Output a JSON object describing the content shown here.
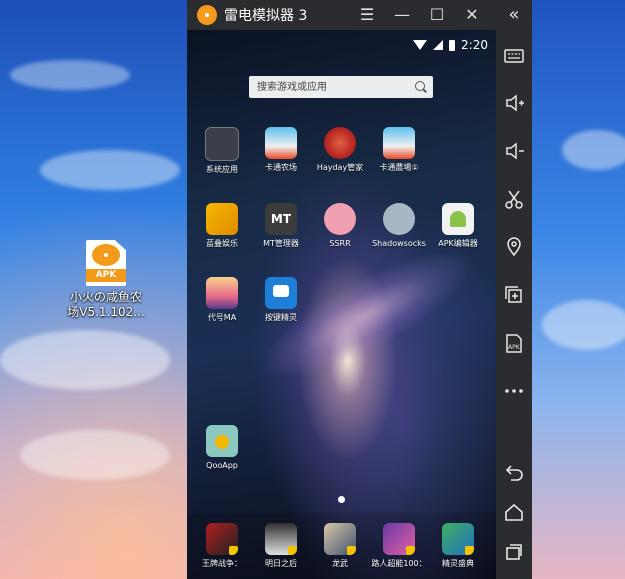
{
  "desktop": {
    "file": {
      "badge": "APK",
      "label_line1": "小火の咸鱼农",
      "label_line2": "场V5.1.102..."
    }
  },
  "window": {
    "title": "雷电模拟器 3",
    "controls": {
      "menu": "☰",
      "minimize": "—",
      "maximize": "☐",
      "close": "✕"
    },
    "collapse": "«"
  },
  "status": {
    "time": "2:20"
  },
  "search": {
    "placeholder": "搜索游戏或应用"
  },
  "apps": [
    {
      "label": "系统应用"
    },
    {
      "label": "卡通农场"
    },
    {
      "label": "Hayday管家"
    },
    {
      "label": "卡通農場①"
    },
    {
      "label": "蓝叠娱乐"
    },
    {
      "label": "MT管理器"
    },
    {
      "label": "SSRR"
    },
    {
      "label": "Shadowsocks"
    },
    {
      "label": "APK编辑器"
    },
    {
      "label": "代号MA"
    },
    {
      "label": "按键精灵"
    },
    {
      "label": "QooApp"
    }
  ],
  "dock": [
    {
      "label": "王牌战争："
    },
    {
      "label": "明日之后"
    },
    {
      "label": "龙武"
    },
    {
      "label": "路人超能100："
    },
    {
      "label": "精灵盛典"
    }
  ],
  "mt_text": "MT",
  "colors": {
    "accent": "#f39a1b",
    "titlebar": "#2b2c2f"
  }
}
